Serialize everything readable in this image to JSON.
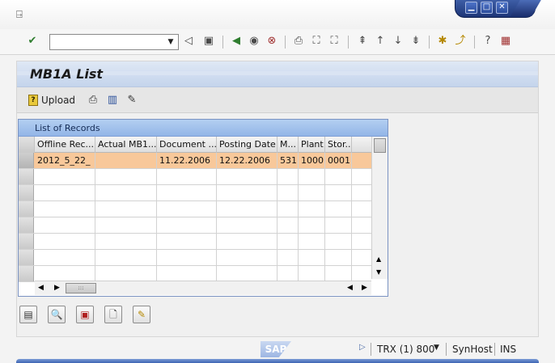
{
  "window": {
    "min_icon": "minimize-icon",
    "max_icon": "maximize-icon",
    "close_icon": "close-icon"
  },
  "menu": {
    "icon": "menu-exit-icon"
  },
  "toolbar": {
    "command_field_value": "",
    "icons": [
      "enter-check-icon",
      "back-triangle-icon",
      "save-icon",
      "back-icon",
      "exit-icon",
      "cancel-icon",
      "print-icon",
      "find-icon",
      "find-next-icon",
      "first-page-icon",
      "previous-page-icon",
      "next-page-icon",
      "last-page-icon",
      "create-session-icon",
      "shortcut-icon",
      "help-icon",
      "layout-icon"
    ]
  },
  "page": {
    "title": "MB1A List"
  },
  "app_toolbar": {
    "upload_label": "Upload",
    "icons": [
      "printer-icon",
      "table-layout-icon",
      "document-edit-icon"
    ]
  },
  "grid": {
    "title": "List of Records",
    "columns": [
      "Offline Rec...",
      "Actual MB1...",
      "Document ...",
      "Posting Date",
      "M...",
      "Plant",
      "Stor..."
    ],
    "rows": [
      [
        "2012_5_22_",
        "",
        "11.22.2006",
        "12.22.2006",
        "531",
        "1000",
        "0001"
      ]
    ],
    "empty_rows": 7
  },
  "bottom_buttons": [
    "details-icon",
    "display-icon",
    "delete-icon",
    "new-document-icon",
    "edit-pencil-icon"
  ],
  "status": {
    "logo": "SAP",
    "system": "TRX (1) 800",
    "host": "SynHost",
    "mode": "INS"
  },
  "colors": {
    "selected_row": "#f8c89a",
    "grid_title": "#b3cff1",
    "title_band": "#c4d4ec",
    "window_accent": "#1d3577"
  }
}
